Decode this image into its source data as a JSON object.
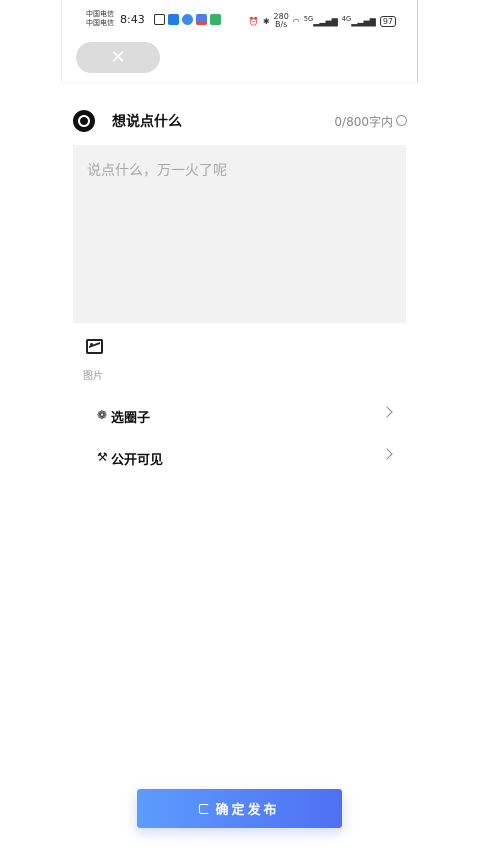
{
  "status_bar": {
    "carrier_1": "中国电信",
    "carrier_2": "中国电信",
    "time": "8:43",
    "net_speed_value": "280",
    "net_speed_unit": "B/s",
    "signal_1": "5G",
    "signal_2": "4G",
    "battery": "97",
    "notification_icons": [
      "nfc-icon",
      "app-icon-blue",
      "cloud-icon",
      "app-icon-red",
      "app-icon-green"
    ]
  },
  "topbar": {
    "close_icon": "✕"
  },
  "compose": {
    "title": "想说点什么",
    "counter": "0/800字内",
    "placeholder": "说点什么，万一火了呢"
  },
  "attachments": {
    "image_label": "图片"
  },
  "options": {
    "circle": {
      "icon": "❁",
      "label": "选圈子"
    },
    "visibility": {
      "icon": "⚒",
      "label": "公开可见"
    }
  },
  "publish": {
    "label": "确定发布"
  },
  "colors": {
    "accent_start": "#5c9cff",
    "accent_end": "#4f70f2",
    "input_bg": "#f2f2f2",
    "close_bg": "#dcdcdc"
  }
}
